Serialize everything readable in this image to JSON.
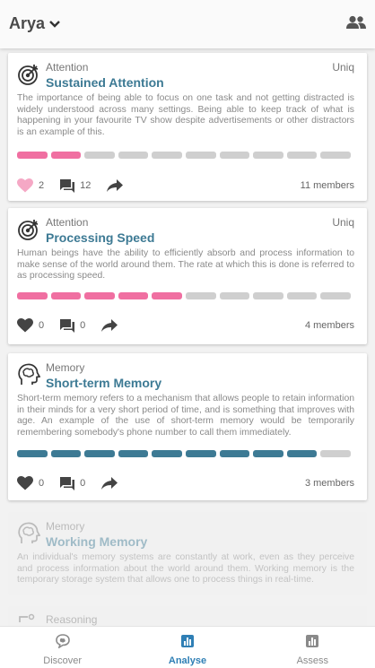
{
  "header": {
    "user_name": "Arya"
  },
  "colors": {
    "accent": "#3d7a94",
    "progress_pink": "#f06fa1",
    "progress_teal": "#3d7a94",
    "progress_empty": "#cfcfcf",
    "like_active": "#f5a8c5",
    "nav_active": "#2f7fb5"
  },
  "cards": [
    {
      "category": "Attention",
      "tag": "Uniq",
      "title": "Sustained Attention",
      "description": "The importance of being able to focus on one task and not getting distracted is widely understood across many settings. Being able to keep track of what is happening in your favourite TV show despite advertisements or other distractors is an example of this.",
      "progress": {
        "filled": 2,
        "total": 10,
        "color": "#f06fa1"
      },
      "likes": "2",
      "liked": true,
      "comments": "12",
      "members": "11 members"
    },
    {
      "category": "Attention",
      "tag": "Uniq",
      "title": "Processing Speed",
      "description": "Human beings have the ability to efficiently absorb and process information to make sense of the world around them. The rate at which this is done is referred to as processing speed.",
      "progress": {
        "filled": 5,
        "total": 10,
        "color": "#f06fa1"
      },
      "likes": "0",
      "liked": false,
      "comments": "0",
      "members": "4 members"
    },
    {
      "category": "Memory",
      "tag": "",
      "title": "Short-term Memory",
      "description": "Short-term memory refers to a mechanism that allows people to retain information in their minds for a very short period of time, and is something that improves with age. An example of the use of short-term memory would be temporarily remembering somebody's phone number to call them immediately.",
      "progress": {
        "filled": 9,
        "total": 10,
        "color": "#3d7a94"
      },
      "likes": "0",
      "liked": false,
      "comments": "0",
      "members": "3 members"
    },
    {
      "category": "Memory",
      "title": "Working Memory",
      "description": "An individual's memory systems are constantly at work, even as they perceive and process information about the world around them. Working memory is the temporary storage system that allows one to process things in real-time."
    },
    {
      "category": "Reasoning"
    }
  ],
  "nav": [
    {
      "label": "Discover",
      "icon": "discover-icon",
      "active": false
    },
    {
      "label": "Analyse",
      "icon": "analyse-icon",
      "active": true
    },
    {
      "label": "Assess",
      "icon": "assess-icon",
      "active": false
    }
  ]
}
